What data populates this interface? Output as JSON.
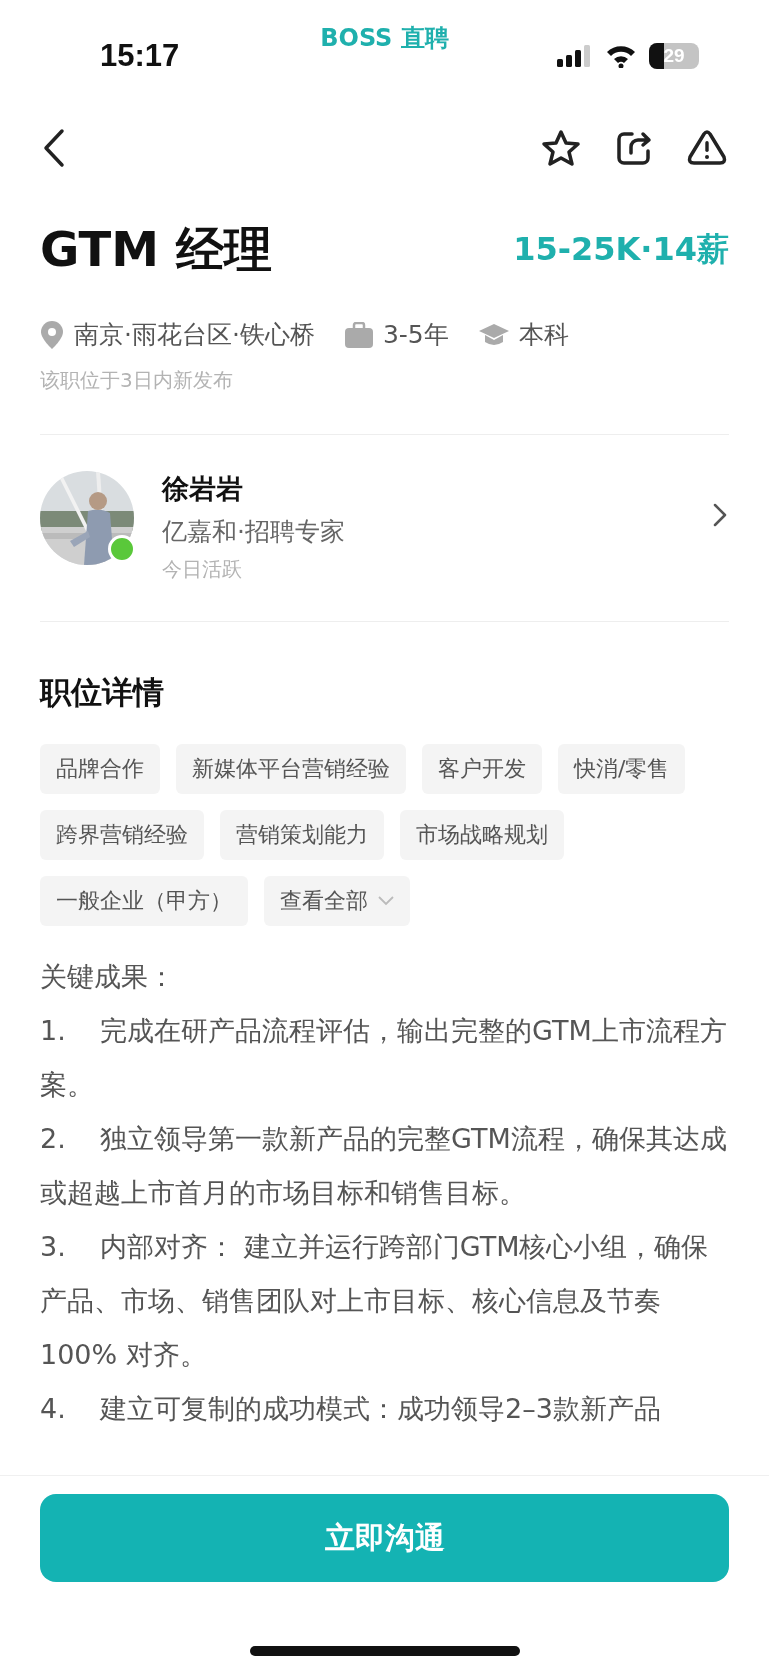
{
  "status_bar": {
    "time": "15:17",
    "app_name": "BOSS 直聘",
    "battery": "29"
  },
  "job": {
    "title": "GTM 经理",
    "salary": "15-25K·14薪",
    "meta": [
      {
        "kind": "location",
        "text": "南京·雨花台区·铁心桥"
      },
      {
        "kind": "experience",
        "text": "3-5年"
      },
      {
        "kind": "education",
        "text": "本科"
      }
    ],
    "posted": "该职位于3日内新发布"
  },
  "recruiter": {
    "name": "徐岩岩",
    "company": "亿嘉和·招聘专家",
    "activity": "今日活跃",
    "online": true
  },
  "details": {
    "heading": "职位详情",
    "tags": [
      {
        "label": "品牌合作",
        "kind": "tag"
      },
      {
        "label": "新媒体平台营销经验",
        "kind": "tag"
      },
      {
        "label": "客户开发",
        "kind": "tag"
      },
      {
        "label": "快消/零售",
        "kind": "tag"
      },
      {
        "label": "跨界营销经验",
        "kind": "tag"
      },
      {
        "label": "营销策划能力",
        "kind": "tag"
      },
      {
        "label": "市场战略规划",
        "kind": "tag"
      },
      {
        "label": "一般企业（甲方）",
        "kind": "tag"
      },
      {
        "label": "查看全部",
        "kind": "more"
      }
    ],
    "description": [
      "关键成果：",
      "1.    完成在研产品流程评估，输出完整的GTM上市流程方案。",
      "2.    独立领导第一款新产品的完整GTM流程，确保其达成或超越上市首月的市场目标和销售目标。",
      "3.    内部对齐： 建立并运行跨部门GTM核心小组，确保产品、市场、销售团队对上市目标、核心信息及节奏 100% 对齐。",
      "4.    建立可复制的成功模式：成功领导2–3款新产品"
    ]
  },
  "action_button": "立即沟通"
}
